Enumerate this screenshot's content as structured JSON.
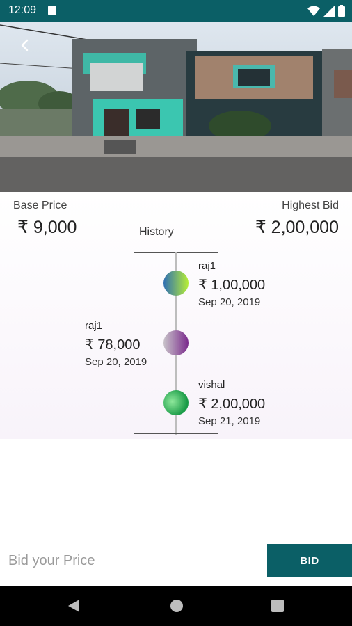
{
  "status_bar": {
    "time": "12:09"
  },
  "listing": {
    "base_price_label": "Base Price",
    "base_price": "₹ 9,000",
    "highest_bid_label": "Highest Bid",
    "highest_bid": "₹ 2,00,000"
  },
  "history": {
    "title": "History",
    "entries": [
      {
        "name": "raj1",
        "amount": "₹ 1,00,000",
        "date": "Sep 20, 2019",
        "side": "right",
        "gradient": [
          "#2f6fb3",
          "#b6ee35"
        ]
      },
      {
        "name": "raj1",
        "amount": "₹ 78,000",
        "date": "Sep 20, 2019",
        "side": "left",
        "gradient": [
          "#c8c3c9",
          "#7a2a8c"
        ]
      },
      {
        "name": "vishal",
        "amount": "₹ 2,00,000",
        "date": "Sep 21, 2019",
        "side": "right",
        "gradient": [
          "#8ee89b",
          "#1a9b47"
        ]
      }
    ]
  },
  "bid_bar": {
    "placeholder": "Bid your Price",
    "button_label": "BID"
  },
  "colors": {
    "primary": "#0b5f66"
  },
  "icons": [
    "sd-card-icon",
    "wifi-icon",
    "cell-signal-icon",
    "battery-icon",
    "back-arrow-icon",
    "nav-back-icon",
    "nav-home-icon",
    "nav-recents-icon"
  ]
}
